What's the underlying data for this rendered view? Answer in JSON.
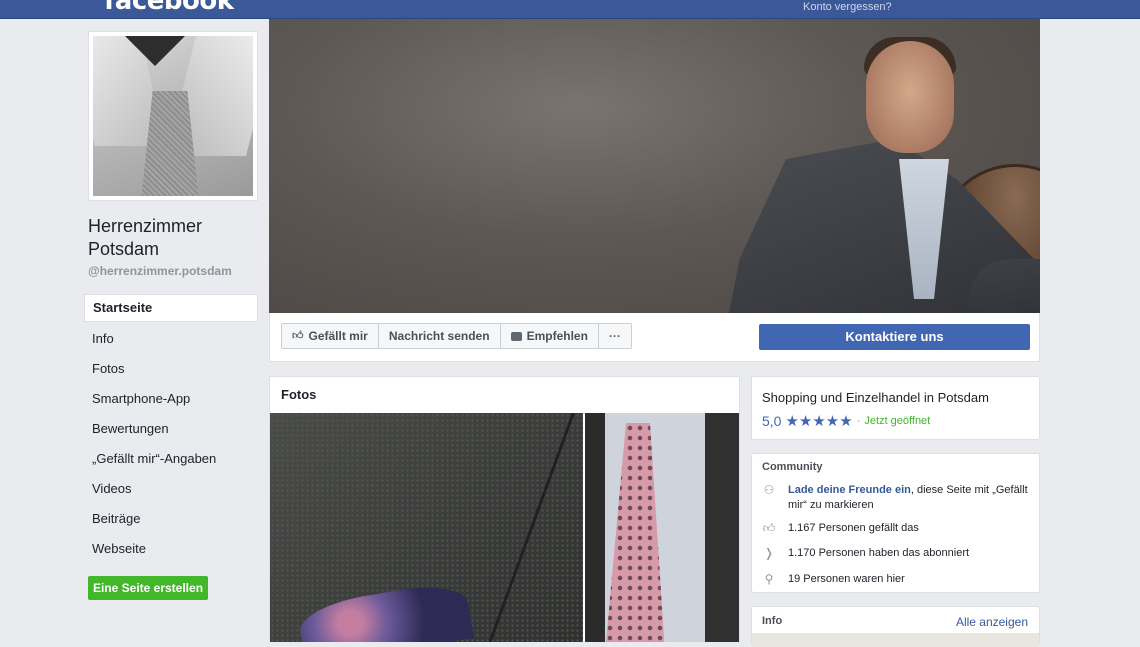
{
  "topbar": {
    "logo": "facebook",
    "forgot_link": "Konto vergessen?"
  },
  "page": {
    "name": "Herrenzimmer Potsdam",
    "handle": "@herrenzimmer.potsdam"
  },
  "nav": {
    "items": [
      "Startseite",
      "Info",
      "Fotos",
      "Smartphone-App",
      "Bewertungen",
      "„Gefällt mir“-Angaben",
      "Videos",
      "Beiträge",
      "Webseite"
    ]
  },
  "create_page_button": "Eine Seite erstellen",
  "actions": {
    "like": "Gefällt mir",
    "message": "Nachricht senden",
    "recommend": "Empfehlen",
    "more": "···",
    "contact": "Kontaktiere uns"
  },
  "photos": {
    "title": "Fotos"
  },
  "category": {
    "title": "Shopping und Einzelhandel in Potsdam",
    "rating": "5,0",
    "stars": "★★★★★",
    "separator": "·",
    "status": "Jetzt geöffnet",
    "rating_value": 5.0
  },
  "community": {
    "title": "Community",
    "invite_link": "Lade deine Freunde ein",
    "invite_rest": ", diese Seite mit „Gefällt mir“ zu markieren",
    "likes": "1.167 Personen gefällt das",
    "follows": "1.170 Personen haben das abonniert",
    "checkins": "19 Personen waren hier"
  },
  "info": {
    "title": "Info",
    "see_all": "Alle anzeigen"
  },
  "colors": {
    "brand": "#3b5998",
    "button_blue": "#4267b2",
    "green": "#42b72a"
  }
}
